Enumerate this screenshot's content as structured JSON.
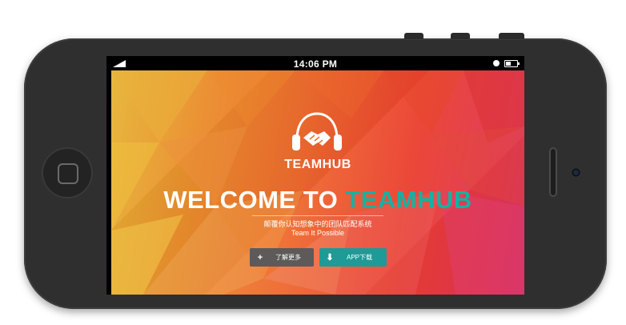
{
  "status_bar": {
    "time": "14:06 PM"
  },
  "hero": {
    "brand": "TEAMHUB",
    "welcome_prefix": "WELCOME TO ",
    "welcome_accent": "TEAMHUB",
    "subtitle_cn": "颠覆你认知想象中的团队匹配系统",
    "subtitle_en": "Team It Possible"
  },
  "buttons": {
    "learn_more_label": "了解更多",
    "app_download_label": "APP下载"
  },
  "colors": {
    "accent": "#17b1a3",
    "button_dark": "#5e5a5a",
    "button_teal": "#1f9a96",
    "phone_body": "#2f2f2f"
  },
  "icons": [
    "signal-icon",
    "alarm-icon",
    "battery-icon",
    "handshake-headphones-logo",
    "plus-icon",
    "download-icon",
    "home-button-icon"
  ]
}
